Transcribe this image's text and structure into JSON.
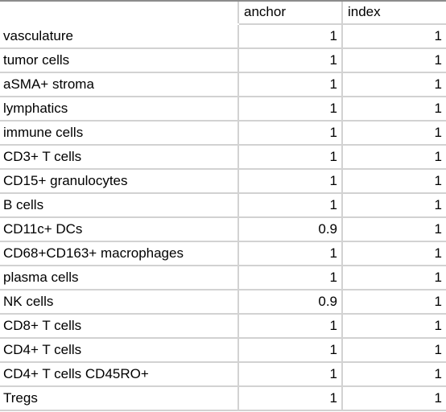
{
  "table": {
    "columns": [
      {
        "key": "label",
        "header": ""
      },
      {
        "key": "anchor",
        "header": "anchor"
      },
      {
        "key": "index",
        "header": "index"
      }
    ],
    "rows": [
      {
        "label": "vasculature",
        "anchor": "1",
        "index": "1"
      },
      {
        "label": "tumor cells",
        "anchor": "1",
        "index": "1"
      },
      {
        "label": "aSMA+ stroma",
        "anchor": "1",
        "index": "1"
      },
      {
        "label": "lymphatics",
        "anchor": "1",
        "index": "1"
      },
      {
        "label": "immune cells",
        "anchor": "1",
        "index": "1"
      },
      {
        "label": "CD3+ T cells",
        "anchor": "1",
        "index": "1"
      },
      {
        "label": "CD15+ granulocytes",
        "anchor": "1",
        "index": "1"
      },
      {
        "label": "B cells",
        "anchor": "1",
        "index": "1"
      },
      {
        "label": "CD11c+ DCs",
        "anchor": "0.9",
        "index": "1"
      },
      {
        "label": "CD68+CD163+ macrophages",
        "anchor": "1",
        "index": "1"
      },
      {
        "label": "plasma cells",
        "anchor": "1",
        "index": "1"
      },
      {
        "label": "NK cells",
        "anchor": "0.9",
        "index": "1"
      },
      {
        "label": "CD8+ T cells",
        "anchor": "1",
        "index": "1"
      },
      {
        "label": "CD4+ T cells",
        "anchor": "1",
        "index": "1"
      },
      {
        "label": "CD4+ T cells CD45RO+",
        "anchor": "1",
        "index": "1"
      },
      {
        "label": "Tregs",
        "anchor": "1",
        "index": "1"
      }
    ]
  },
  "colors": {
    "top_border": "#8c8c8c",
    "grid_line": "#d2d2d2",
    "text": "#000000",
    "background": "#ffffff"
  }
}
